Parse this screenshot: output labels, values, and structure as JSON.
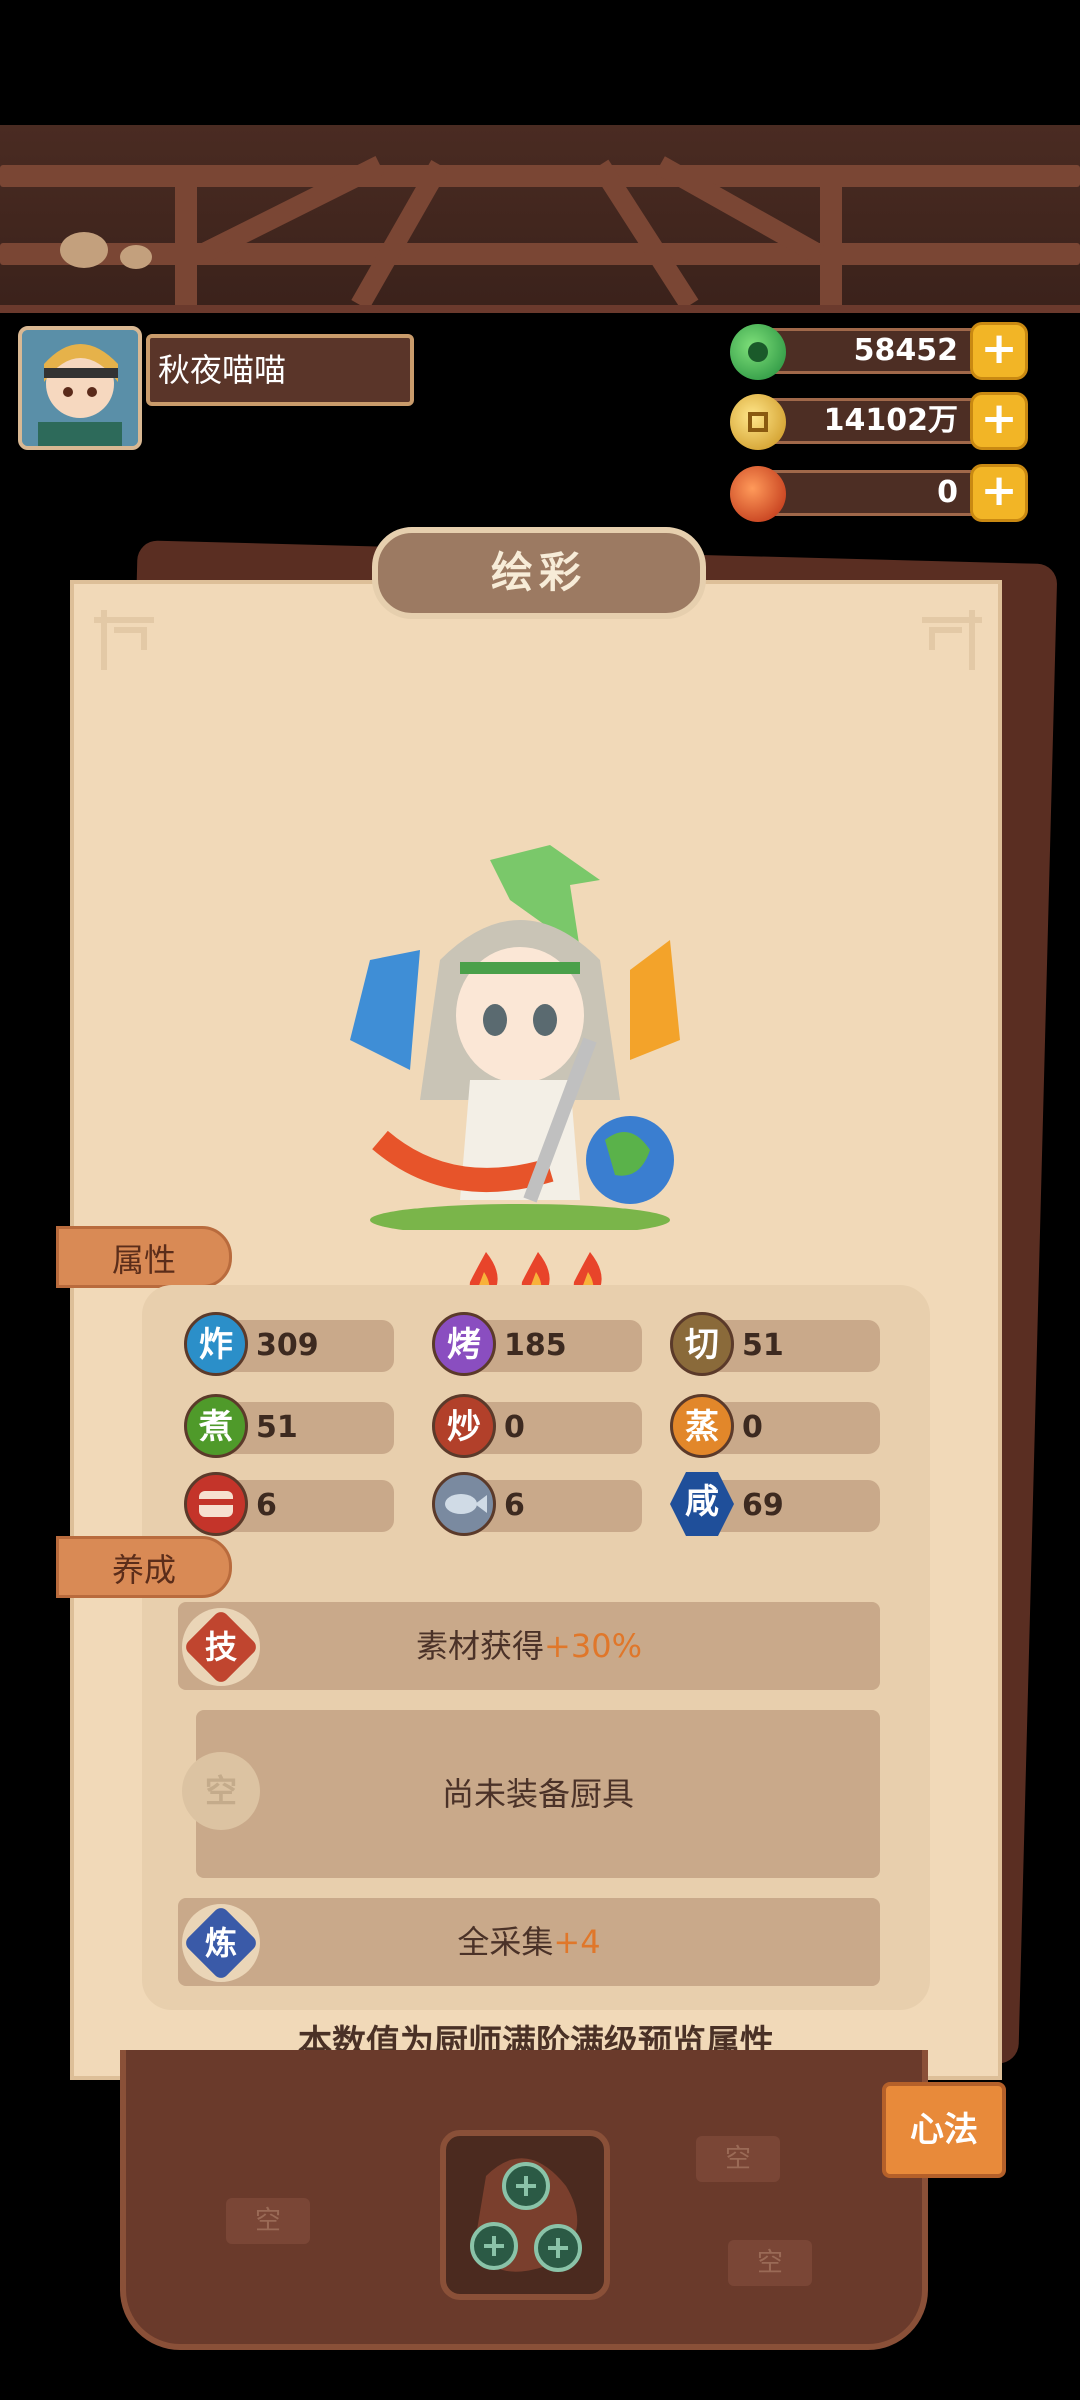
{
  "player": {
    "name": "秋夜喵喵"
  },
  "currencies": [
    {
      "name": "jade",
      "value": "58452",
      "color": "#2fa34a"
    },
    {
      "name": "coin",
      "value": "14102万",
      "color": "#e3b22a"
    },
    {
      "name": "fire-gem",
      "value": "0",
      "color": "#d2461f"
    }
  ],
  "panel": {
    "title": "绘彩",
    "flames": 3,
    "attributes_tab": "属性",
    "develop_tab": "养成",
    "stats": [
      {
        "glyph": "炸",
        "value": "309",
        "color": "#2b8fc9"
      },
      {
        "glyph": "烤",
        "value": "185",
        "color": "#8a4ec0"
      },
      {
        "glyph": "切",
        "value": "51",
        "color": "#8a6a3a"
      },
      {
        "glyph": "煮",
        "value": "51",
        "color": "#4f9a2a"
      },
      {
        "glyph": "炒",
        "value": "0",
        "color": "#b2402a"
      },
      {
        "glyph": "蒸",
        "value": "0",
        "color": "#e2872a"
      },
      {
        "glyph": "",
        "value": "6",
        "color": "#c4342a",
        "icon": "meat-icon"
      },
      {
        "glyph": "",
        "value": "6",
        "color": "#7a8aa0",
        "icon": "fish-icon"
      },
      {
        "glyph": "咸",
        "value": "69",
        "color": "#1f4f9a",
        "icon": "hexagon"
      }
    ],
    "develop": [
      {
        "glyph": "技",
        "text": "素材获得",
        "bonus": "+30%",
        "color": "#c0452f"
      },
      {
        "glyph": "空",
        "text": "尚未装备厨具",
        "bonus": "",
        "color": "#e0c8a6"
      },
      {
        "glyph": "炼",
        "text": "全采集",
        "bonus": "+4",
        "color": "#3a5aa8"
      }
    ],
    "footer_note": "本数值为厨师满阶满级预览属性"
  },
  "bottom": {
    "xinfa_label": "心法",
    "empty_label": "空"
  }
}
